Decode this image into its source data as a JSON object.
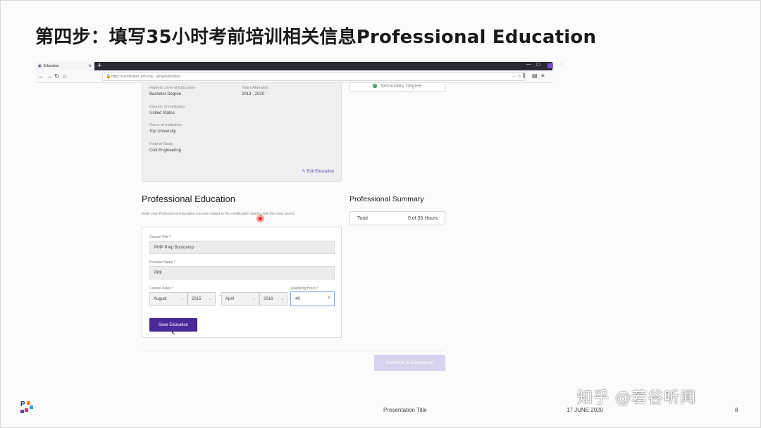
{
  "slide": {
    "title": "第四步：填写35小时考前培训相关信息Professional Education",
    "footer_center": "Presentation Title",
    "footer_date": "17 JUNE 2020",
    "page_number": "8",
    "watermark": "知乎 @若谷听闻"
  },
  "browser": {
    "tab_title": "Education",
    "tab_close": "×",
    "new_tab": "+",
    "url": "https://certification.pmi.org/.../pmp/education",
    "min": "—",
    "max": "☐",
    "close": "✕"
  },
  "education_summary": {
    "highest_level_label": "Highest Level of Education",
    "highest_level_value": "Bachelor Degree",
    "years_label": "Years Attended",
    "years_value": "2013 - 2020",
    "country_label": "Country of Institution",
    "country_value": "United States",
    "institution_label": "Name of Institution",
    "institution_value": "Top University",
    "field_label": "Field of Study",
    "field_value": "Civil Engineering",
    "edit_label": "Edit Education"
  },
  "secondary_badge": "Secondary Degree",
  "professional_education": {
    "title": "Professional Education",
    "subtitle": "Enter your Professional Education courses related to this certification starting with the most recent.",
    "course_title_label": "Course Title *",
    "course_title_value": "PMP Prep Bootcamp",
    "provider_label": "Provider Name *",
    "provider_value": "PMI",
    "dates_label": "Course Dates *",
    "start_month": "August",
    "start_year": "2015",
    "end_month": "April",
    "end_year": "2016",
    "hours_label": "Qualifying Hours *",
    "hours_value": "40",
    "save_label": "Save Education"
  },
  "summary": {
    "title": "Professional Summary",
    "total_label": "Total",
    "total_value": "0 of 35 Hours"
  },
  "continue_label": "Continue to Experience"
}
